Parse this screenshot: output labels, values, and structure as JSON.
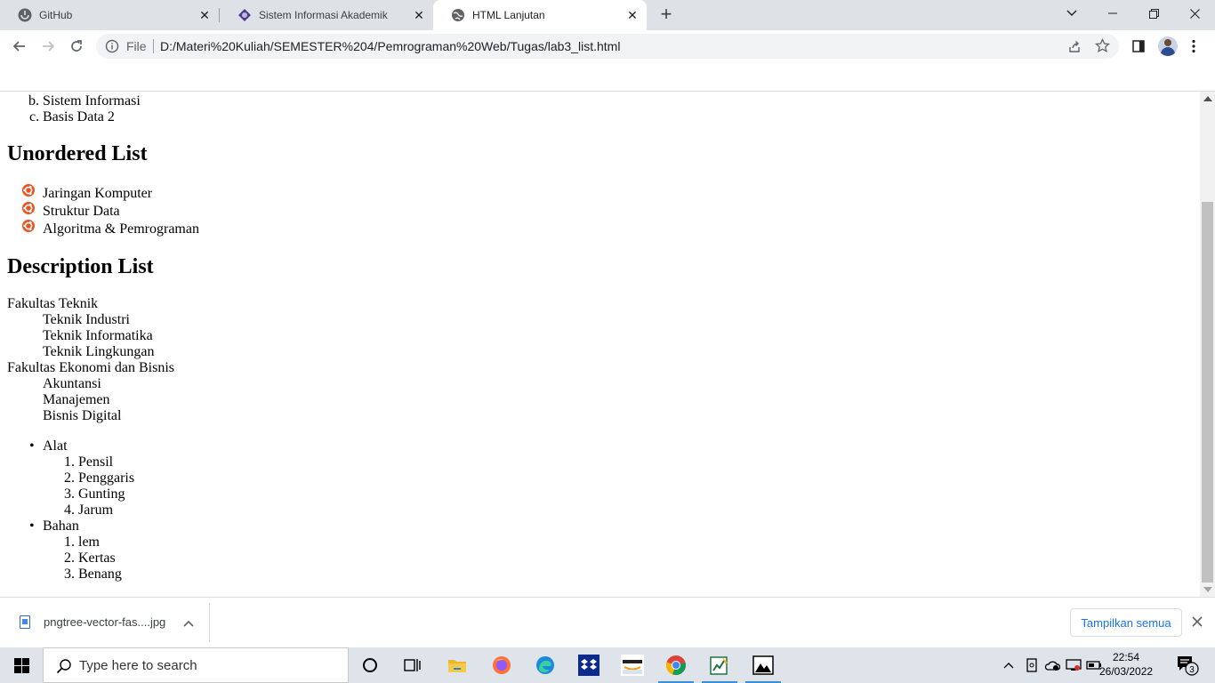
{
  "browser": {
    "tabs": [
      {
        "label": "GitHub",
        "icon": "github-icon"
      },
      {
        "label": "Sistem Informasi Akademik",
        "icon": "university-logo-icon"
      },
      {
        "label": "HTML Lanjutan",
        "icon": "globe-icon",
        "active": true
      }
    ],
    "omnibox": {
      "scheme_label": "File",
      "url": "D:/Materi%20Kuliah/SEMESTER%204/Pemrograman%20Web/Tugas/lab3_list.html"
    }
  },
  "page": {
    "ordered_list_tail": [
      {
        "marker": "b.",
        "text": "Sistem Informasi"
      },
      {
        "marker": "c.",
        "text": "Basis Data 2"
      }
    ],
    "unordered_heading": "Unordered List",
    "unordered_items": [
      "Jaringan Komputer",
      "Struktur Data",
      "Algoritma & Pemrograman"
    ],
    "unordered_bullet_icon": "ubuntu-logo-icon",
    "description_heading": "Description List",
    "description_list": [
      {
        "term": "Fakultas Teknik",
        "defs": [
          "Teknik Industri",
          "Teknik Informatika",
          "Teknik Lingkungan"
        ]
      },
      {
        "term": "Fakultas Ekonomi dan Bisnis",
        "defs": [
          "Akuntansi",
          "Manajemen",
          "Bisnis Digital"
        ]
      }
    ],
    "nested_list": [
      {
        "label": "Alat",
        "items": [
          {
            "marker": "1.",
            "text": "Pensil"
          },
          {
            "marker": "2.",
            "text": "Penggaris"
          },
          {
            "marker": "3.",
            "text": "Gunting"
          },
          {
            "marker": "4.",
            "text": "Jarum"
          }
        ]
      },
      {
        "label": "Bahan",
        "items": [
          {
            "marker": "1.",
            "text": "lem"
          },
          {
            "marker": "2.",
            "text": "Kertas"
          },
          {
            "marker": "3.",
            "text": "Benang"
          }
        ]
      }
    ]
  },
  "download_bar": {
    "filename": "pngtree-vector-fas....jpg",
    "show_all_label": "Tampilkan semua"
  },
  "taskbar": {
    "search_placeholder": "Type here to search",
    "time": "22:54",
    "date": "26/03/2022",
    "notification_count": "3",
    "apps": [
      "cortana-icon",
      "task-view-icon",
      "file-explorer-icon",
      "firefox-icon",
      "edge-icon",
      "dropbox-icon",
      "amazon-icon",
      "chrome-icon",
      "office-app-icon",
      "photos-icon"
    ]
  },
  "colors": {
    "tabstrip_bg": "#dee1e6",
    "ubuntu_orange": "#e95420",
    "link_blue": "#1a73e8",
    "taskbar_bg": "#dfe4ea"
  }
}
